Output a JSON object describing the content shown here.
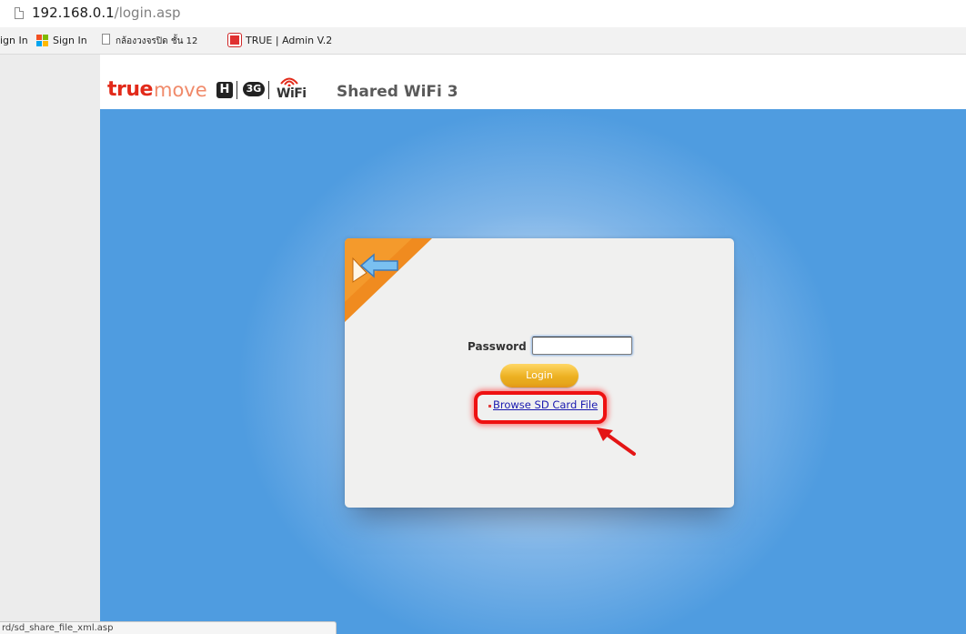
{
  "address_bar": {
    "host": "192.168.0.1",
    "path": "/login.asp",
    "icon": "page-icon"
  },
  "bookmarks": [
    {
      "label": "ign In",
      "icon": ""
    },
    {
      "label": "Sign In",
      "icon": "microsoft-icon"
    },
    {
      "label": "กล้องวงจรปิด ชั้น 12",
      "icon": "page-icon"
    },
    {
      "label": "TRUE | Admin V.2",
      "icon": "true-icon"
    }
  ],
  "header": {
    "logo_true": "true",
    "logo_move": "move",
    "logo_h": "H",
    "logo_3g": "3G",
    "logo_wifi": "WiFi",
    "title": "Shared WiFi 3"
  },
  "login": {
    "password_label": "Password",
    "password_value": "",
    "login_button": "Login",
    "browse_link": "Browse SD Card File"
  },
  "status_bar": {
    "text": "rd/sd_share_file_xml.asp"
  },
  "colors": {
    "accent_blue": "#4f9ce0",
    "orange": "#f08b1f",
    "highlight_red": "#ee1111",
    "login_button": "#ecb021"
  }
}
